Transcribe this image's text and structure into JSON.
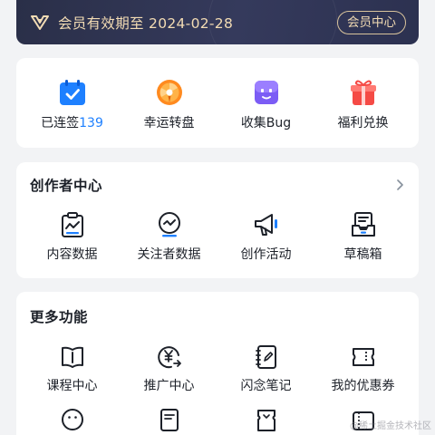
{
  "banner": {
    "text": "会员有效期至 2024-02-28",
    "button_label": "会员中心",
    "icon": "vip-crown-icon",
    "text_color": "#f3dcb4"
  },
  "quick_actions": [
    {
      "label": "已连签",
      "count": "139",
      "icon": "calendar-check-icon"
    },
    {
      "label": "幸运转盘",
      "icon": "lucky-wheel-icon"
    },
    {
      "label": "收集Bug",
      "icon": "bug-collect-icon"
    },
    {
      "label": "福利兑换",
      "icon": "gift-icon"
    }
  ],
  "creator_center": {
    "title": "创作者中心",
    "items": [
      {
        "label": "内容数据",
        "icon": "content-data-icon"
      },
      {
        "label": "关注者数据",
        "icon": "follower-data-icon"
      },
      {
        "label": "创作活动",
        "icon": "megaphone-icon"
      },
      {
        "label": "草稿箱",
        "icon": "drafts-icon"
      }
    ]
  },
  "more_features": {
    "title": "更多功能",
    "items": [
      {
        "label": "课程中心",
        "icon": "course-book-icon"
      },
      {
        "label": "推广中心",
        "icon": "promotion-yen-icon"
      },
      {
        "label": "闪念笔记",
        "icon": "notebook-icon"
      },
      {
        "label": "我的优惠券",
        "icon": "coupon-icon"
      }
    ],
    "row2_icons": [
      "smiley-icon",
      "document-icon",
      "ticket-icon",
      "coupon2-icon"
    ]
  },
  "watermark": "@稀土掘金技术社区",
  "accent_color": "#1e80ff"
}
